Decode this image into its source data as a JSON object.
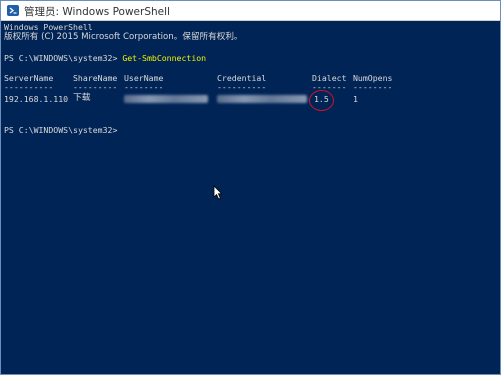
{
  "window": {
    "title": "管理员: Windows PowerShell"
  },
  "console": {
    "banner_line1": "Windows PowerShell",
    "banner_line2": "版权所有 (C) 2015 Microsoft Corporation。保留所有权利。",
    "prompt1": "PS C:\\WINDOWS\\system32> ",
    "command": "Get-SmbConnection",
    "headers": [
      "ServerName",
      "ShareName",
      "UserName",
      "Credential",
      "Dialect",
      "NumOpens"
    ],
    "separators": [
      "----------",
      "---------",
      "--------",
      "----------",
      "-------",
      "--------"
    ],
    "row": {
      "server": "192.168.1.110",
      "share": "下载",
      "dialect": "1.5",
      "numopens": "1"
    },
    "prompt2": "PS C:\\WINDOWS\\system32>"
  },
  "colors": {
    "background": "#012456",
    "text": "#d9d9d9",
    "command": "#f2f200",
    "highlight_circle": "#d4102a"
  }
}
